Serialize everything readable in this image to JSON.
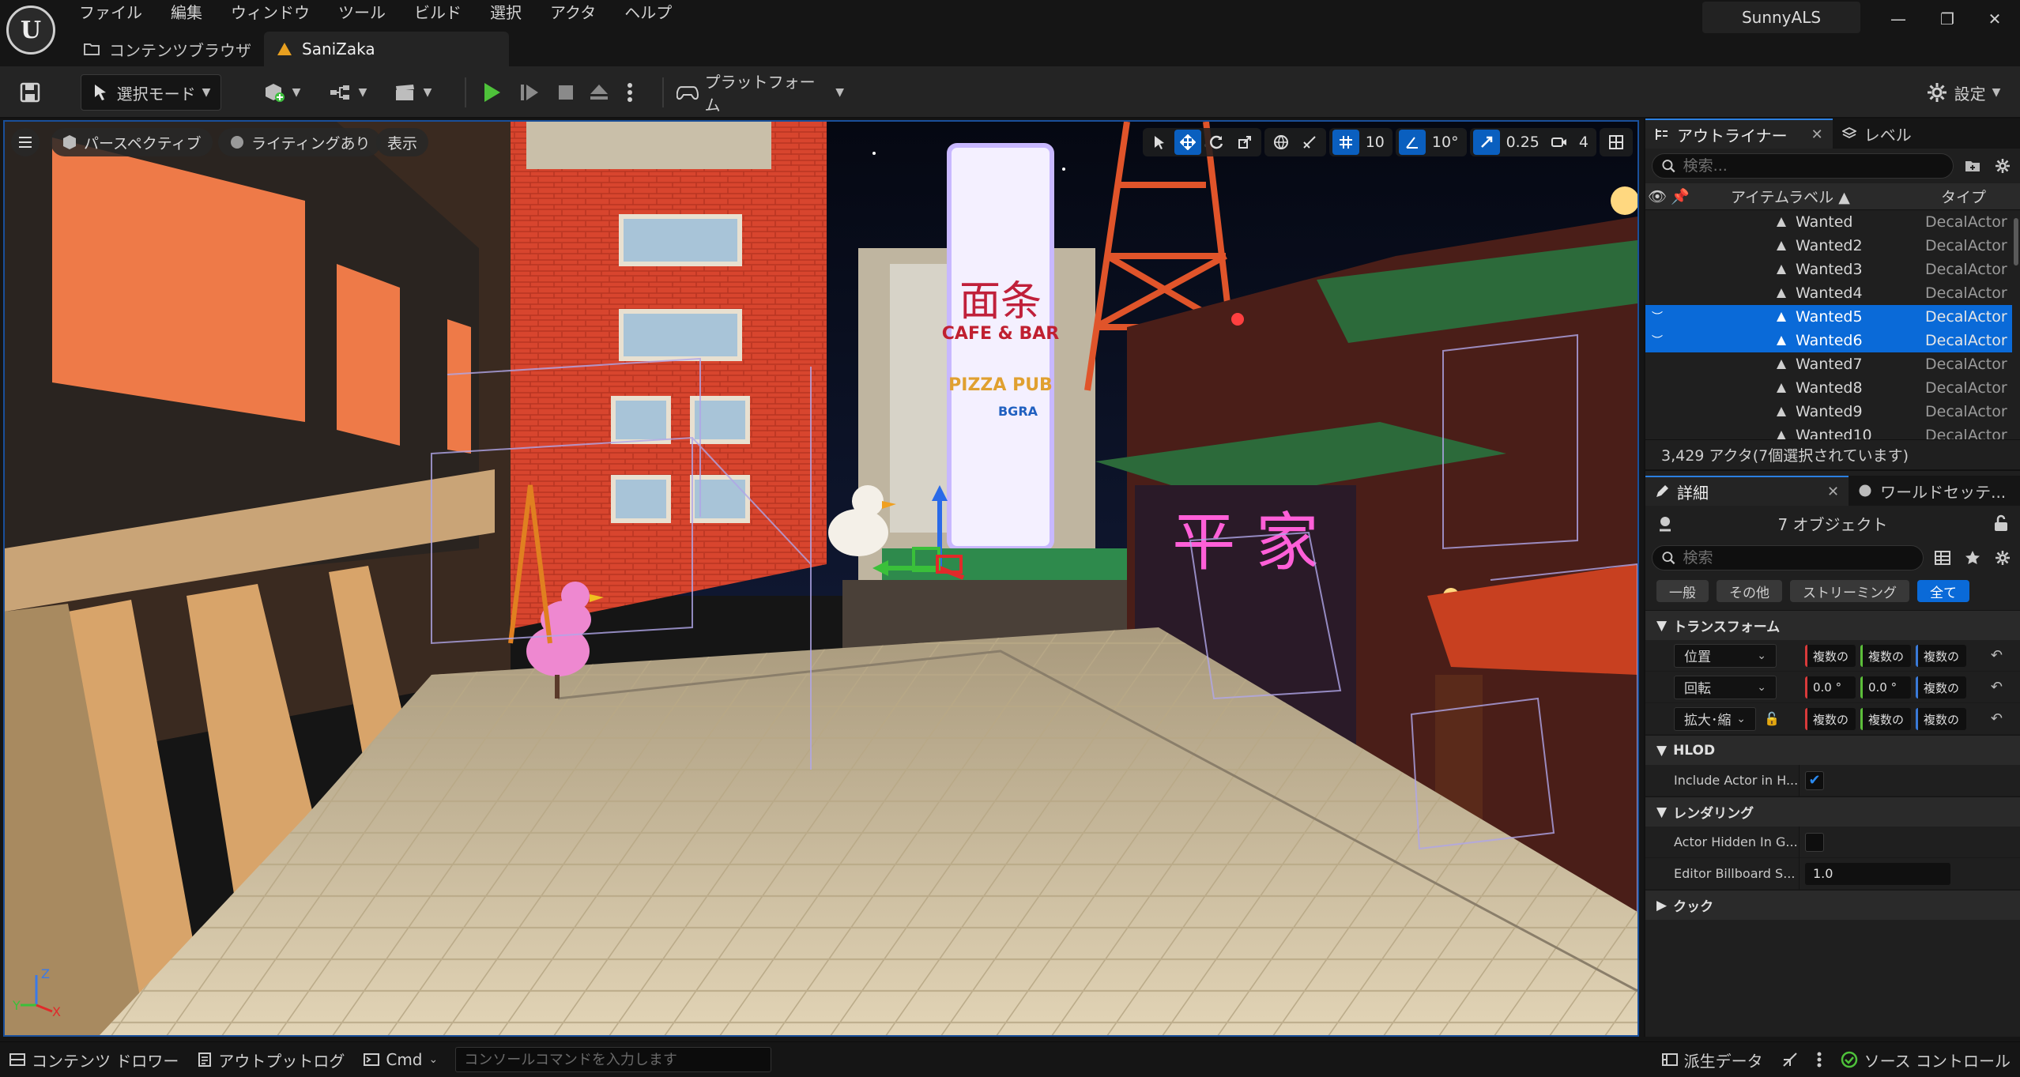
{
  "app": {
    "logo_text": "U",
    "project_name": "SunnyALS"
  },
  "menu": [
    "ファイル",
    "編集",
    "ウィンドウ",
    "ツール",
    "ビルド",
    "選択",
    "アクタ",
    "ヘルプ"
  ],
  "doc_tabs": [
    {
      "label": "コンテンツブラウザ",
      "icon": "folder-icon"
    },
    {
      "label": "SaniZaka",
      "icon": "level-icon"
    }
  ],
  "window_controls": {
    "minimize": "—",
    "restore": "❐",
    "close": "✕"
  },
  "toolbar": {
    "mode_label": "選択モード",
    "platform_label": "プラットフォーム",
    "settings_label": "設定"
  },
  "viewport": {
    "view_mode": "パースペクティブ",
    "lighting": "ライティングあり",
    "show": "表示",
    "grid_snap": "10",
    "rotation_snap": "10°",
    "scale_snap": "0.25",
    "camera_speed": "4",
    "neon_sign_text": "平 家",
    "sign_text": "面条",
    "sign_subtitle": "CAFE & BAR",
    "pizza_text": "PIZZA PUB",
    "sign_small": "BGRA"
  },
  "outliner": {
    "tab_label": "アウトライナー",
    "level_tab_label": "レベル",
    "search_placeholder": "検索...",
    "col_label": "アイテムラベル ▲",
    "col_type": "タイプ",
    "rows": [
      {
        "name": "Wanted",
        "type": "DecalActor",
        "selected": false
      },
      {
        "name": "Wanted2",
        "type": "DecalActor",
        "selected": false
      },
      {
        "name": "Wanted3",
        "type": "DecalActor",
        "selected": false
      },
      {
        "name": "Wanted4",
        "type": "DecalActor",
        "selected": false
      },
      {
        "name": "Wanted5",
        "type": "DecalActor",
        "selected": true
      },
      {
        "name": "Wanted6",
        "type": "DecalActor",
        "selected": true
      },
      {
        "name": "Wanted7",
        "type": "DecalActor",
        "selected": false
      },
      {
        "name": "Wanted8",
        "type": "DecalActor",
        "selected": false
      },
      {
        "name": "Wanted9",
        "type": "DecalActor",
        "selected": false
      },
      {
        "name": "Wanted10",
        "type": "DecalActor",
        "selected": false
      }
    ],
    "status": "3,429 アクタ(7個選択されています)"
  },
  "details": {
    "tab_label": "詳細",
    "world_tab_label": "ワールドセッテ...",
    "object_count": "7 オブジェクト",
    "search_placeholder": "検索",
    "filters": [
      {
        "label": "一般",
        "active": false
      },
      {
        "label": "その他",
        "active": false
      },
      {
        "label": "ストリーミング",
        "active": false
      },
      {
        "label": "全て",
        "active": true
      }
    ],
    "transform": {
      "title": "トランスフォーム",
      "location": {
        "label": "位置",
        "x": "複数の",
        "y": "複数の",
        "z": "複数の"
      },
      "rotation": {
        "label": "回転",
        "x": "0.0 °",
        "y": "0.0 °",
        "z": "複数の"
      },
      "scale": {
        "label": "拡大･縮",
        "x": "複数の",
        "y": "複数の",
        "z": "複数の"
      }
    },
    "hlod": {
      "title": "HLOD",
      "include_label": "Include Actor in H...",
      "include_checked": "✔"
    },
    "rendering": {
      "title": "レンダリング",
      "hidden_label": "Actor Hidden In G...",
      "billboard_label": "Editor Billboard S...",
      "billboard_value": "1.0"
    },
    "cook": {
      "title": "クック"
    }
  },
  "statusbar": {
    "content_drawer": "コンテンツ ドロワー",
    "output_log": "アウトプットログ",
    "cmd": "Cmd",
    "console_placeholder": "コンソールコマンドを入力します",
    "derived_data": "派生データ",
    "source_control": "ソース コントロール"
  }
}
